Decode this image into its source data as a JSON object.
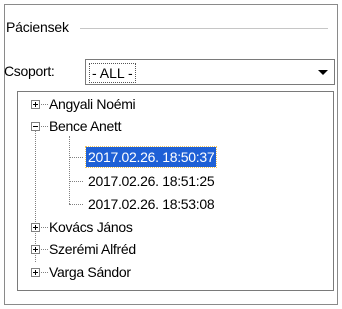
{
  "group": {
    "title": "Páciensek"
  },
  "filter": {
    "label": "Csoport:",
    "value": "- ALL -"
  },
  "tree": {
    "patients": [
      {
        "name": "Angyali Noémi",
        "expanded": false
      },
      {
        "name": "Bence Anett",
        "expanded": true,
        "sessions": [
          {
            "label": "2017.02.26. 18:50:37",
            "selected": true
          },
          {
            "label": "2017.02.26. 18:51:25",
            "selected": false
          },
          {
            "label": "2017.02.26. 18:53:08",
            "selected": false
          }
        ]
      },
      {
        "name": "Kovács János",
        "expanded": false
      },
      {
        "name": "Szerémi Alfréd",
        "expanded": false
      },
      {
        "name": "Varga Sándor",
        "expanded": false
      }
    ]
  },
  "icons": {
    "combo_arrow": "chevron-down-icon",
    "expand": "plus-box-icon",
    "collapse": "minus-box-icon"
  },
  "colors": {
    "selection_background": "#1e60d6",
    "selection_text": "#ffffff",
    "border": "#7a7a7a"
  }
}
